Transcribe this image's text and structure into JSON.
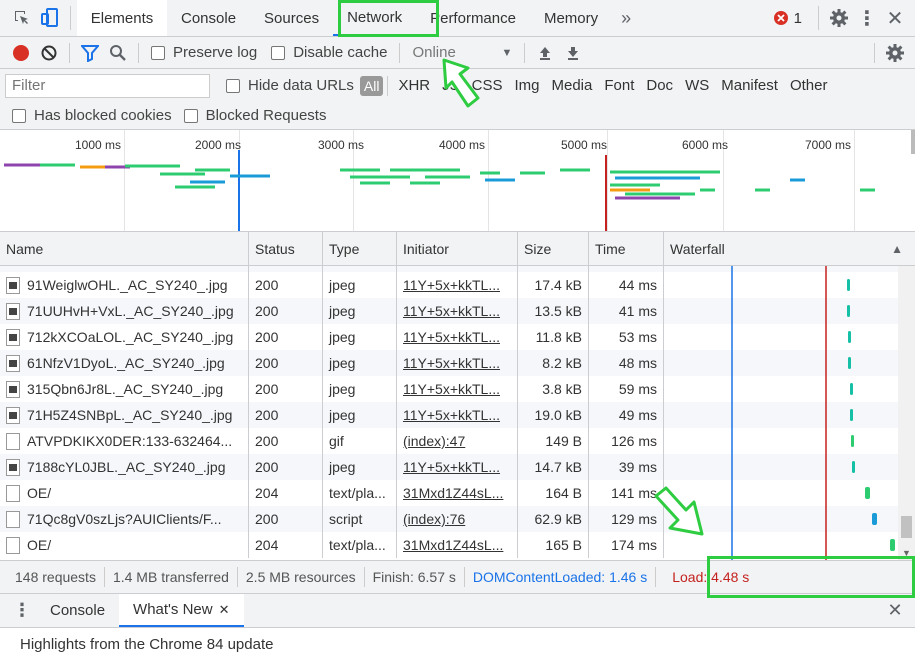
{
  "tabs": [
    {
      "label": "Elements",
      "active": true
    },
    {
      "label": "Console"
    },
    {
      "label": "Sources"
    },
    {
      "label": "Network",
      "selected": true
    },
    {
      "label": "Performance"
    },
    {
      "label": "Memory"
    }
  ],
  "error_count": "1",
  "toolbar": {
    "preserve_log": "Preserve log",
    "disable_cache": "Disable cache",
    "throttle": "Online"
  },
  "filter": {
    "placeholder": "Filter",
    "hide_data_urls": "Hide data URLs",
    "types": [
      "All",
      "XHR",
      "JS",
      "CSS",
      "Img",
      "Media",
      "Font",
      "Doc",
      "WS",
      "Manifest",
      "Other"
    ],
    "has_blocked_cookies": "Has blocked cookies",
    "blocked_requests": "Blocked Requests"
  },
  "overview": {
    "ticks": [
      "1000 ms",
      "2000 ms",
      "3000 ms",
      "4000 ms",
      "5000 ms",
      "6000 ms",
      "7000 ms"
    ]
  },
  "columns": {
    "name": "Name",
    "status": "Status",
    "type": "Type",
    "initiator": "Initiator",
    "size": "Size",
    "time": "Time",
    "waterfall": "Waterfall"
  },
  "rows": [
    {
      "name": "91WeiglwOHL._AC_SY240_.jpg",
      "status": "200",
      "type": "jpeg",
      "initiator": "11Y+5x+kkTL...",
      "size": "17.4 kB",
      "time": "44 ms",
      "icon": "img",
      "wf": 0.73
    },
    {
      "name": "71UUHvH+VxL._AC_SY240_.jpg",
      "status": "200",
      "type": "jpeg",
      "initiator": "11Y+5x+kkTL...",
      "size": "13.5 kB",
      "time": "41 ms",
      "icon": "img",
      "wf": 0.73
    },
    {
      "name": "712kXCOaLOL._AC_SY240_.jpg",
      "status": "200",
      "type": "jpeg",
      "initiator": "11Y+5x+kkTL...",
      "size": "11.8 kB",
      "time": "53 ms",
      "icon": "img",
      "wf": 0.735
    },
    {
      "name": "61NfzV1DyoL._AC_SY240_.jpg",
      "status": "200",
      "type": "jpeg",
      "initiator": "11Y+5x+kkTL...",
      "size": "8.2 kB",
      "time": "48 ms",
      "icon": "img",
      "wf": 0.735
    },
    {
      "name": "315Qbn6Jr8L._AC_SY240_.jpg",
      "status": "200",
      "type": "jpeg",
      "initiator": "11Y+5x+kkTL...",
      "size": "3.8 kB",
      "time": "59 ms",
      "icon": "img",
      "wf": 0.74
    },
    {
      "name": "71H5Z4SNBpL._AC_SY240_.jpg",
      "status": "200",
      "type": "jpeg",
      "initiator": "11Y+5x+kkTL...",
      "size": "19.0 kB",
      "time": "49 ms",
      "icon": "img",
      "wf": 0.74
    },
    {
      "name": "ATVPDKIKX0DER:133-632464...",
      "status": "200",
      "type": "gif",
      "initiator": "(index):47",
      "size": "149 B",
      "time": "126 ms",
      "icon": "doc",
      "wf": 0.745
    },
    {
      "name": "7188cYL0JBL._AC_SY240_.jpg",
      "status": "200",
      "type": "jpeg",
      "initiator": "11Y+5x+kkTL...",
      "size": "14.7 kB",
      "time": "39 ms",
      "icon": "img",
      "wf": 0.75
    },
    {
      "name": "OE/",
      "status": "204",
      "type": "text/pla...",
      "initiator": "31Mxd1Z44sL...",
      "size": "164 B",
      "time": "141 ms",
      "icon": "doc",
      "wf": 0.8
    },
    {
      "name": "71Qc8gV0szLjs?AUIClients/F...",
      "status": "200",
      "type": "script",
      "initiator": "(index):76",
      "size": "62.9 kB",
      "time": "129 ms",
      "icon": "doc",
      "wf": 0.83
    },
    {
      "name": "OE/",
      "status": "204",
      "type": "text/pla...",
      "initiator": "31Mxd1Z44sL...",
      "size": "165 B",
      "time": "174 ms",
      "icon": "doc",
      "wf": 0.9
    }
  ],
  "summary": {
    "requests": "148 requests",
    "transferred": "1.4 MB transferred",
    "resources": "2.5 MB resources",
    "finish": "Finish: 6.57 s",
    "dcl": "DOMContentLoaded: 1.46 s",
    "load": "Load: 4.48 s"
  },
  "drawer": {
    "tabs": [
      "Console",
      "What's New"
    ],
    "message": "Highlights from the Chrome 84 update"
  },
  "colors": {
    "record": "#d93025",
    "accent": "#1a73e8",
    "annotation": "#2ecc40",
    "dcl_line": "#1a73e8",
    "load_line": "#c5221f"
  }
}
